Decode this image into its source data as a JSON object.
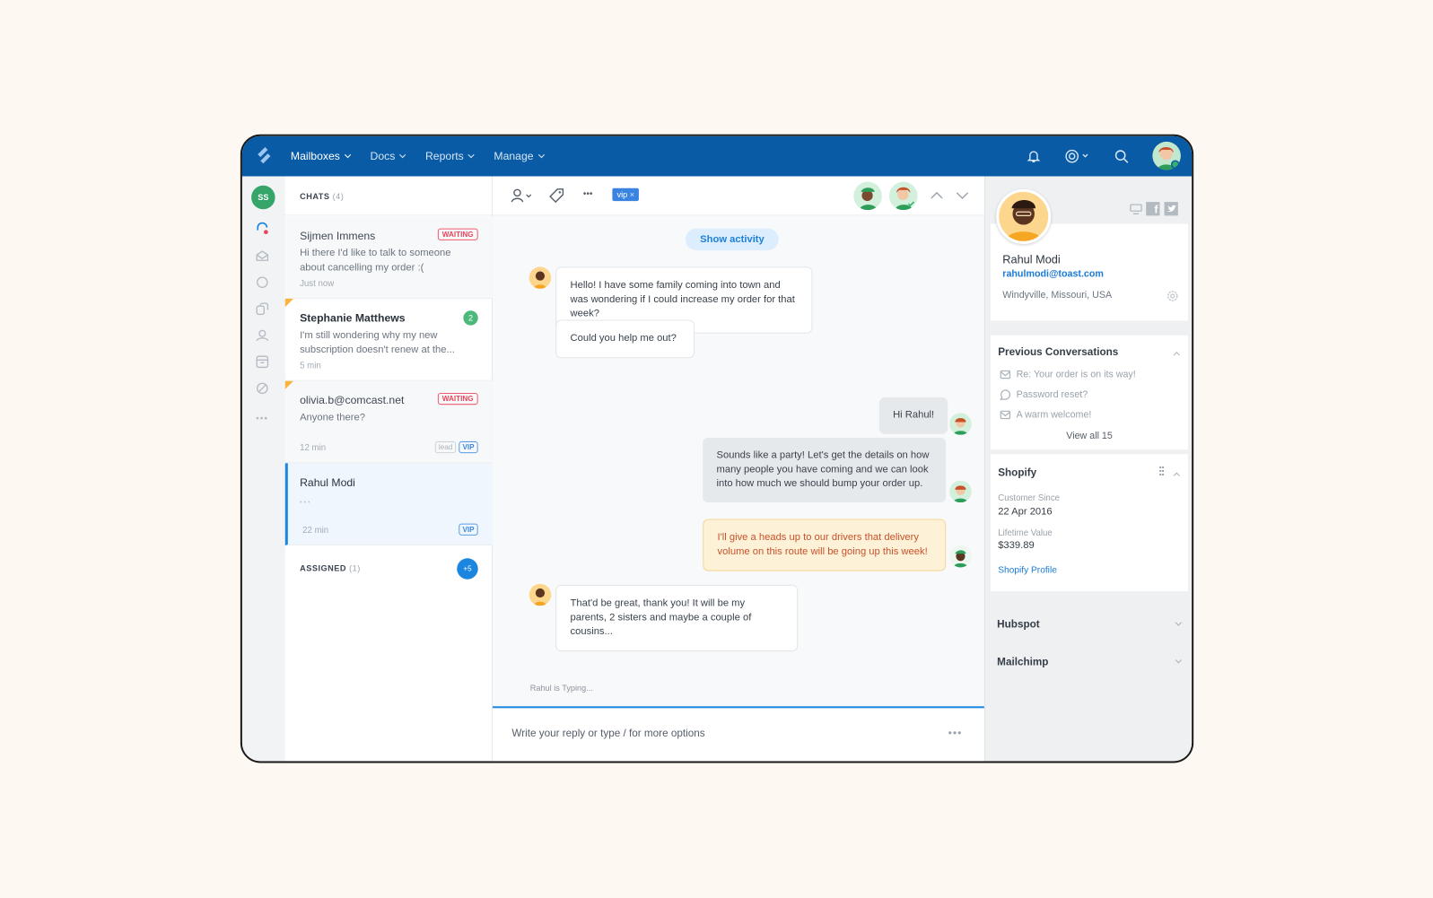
{
  "topbar": {
    "nav": [
      "Mailboxes",
      "Docs",
      "Reports",
      "Manage"
    ]
  },
  "rail": {
    "user_initials": "SS"
  },
  "chats": {
    "title": "CHATS",
    "count": "(4)",
    "items": [
      {
        "name": "Sijmen Immens",
        "preview": "Hi there I'd like to talk to someone about cancelling my order :(",
        "time": "Just now",
        "badge": "WAITING"
      },
      {
        "name": "Stephanie Matthews",
        "preview": "I'm still wondering why my new subscription doesn't renew at the...",
        "time": "5 min",
        "unread": "2"
      },
      {
        "name": "olivia.b@comcast.net",
        "preview": "Anyone there?",
        "time": "12 min",
        "badge": "WAITING",
        "tags": [
          "lead",
          "VIP"
        ]
      },
      {
        "name": "Rahul Modi",
        "preview": "• • •",
        "time": "22 min",
        "tags": [
          "VIP"
        ]
      }
    ],
    "assigned_label": "ASSIGNED",
    "assigned_count": "(1)",
    "assigned_more": "+5"
  },
  "conversation": {
    "tag": "vip",
    "tag_remove": "×",
    "show_activity": "Show activity",
    "messages": [
      {
        "from": "customer",
        "text": "Hello! I have some family coming into town and was wondering if I could increase my order for that week?"
      },
      {
        "from": "customer",
        "text": "Could you help me out?"
      },
      {
        "from": "agent",
        "text": "Hi Rahul!"
      },
      {
        "from": "agent",
        "text": "Sounds like a party! Let's get the details on how many people you have coming and we can look into how much we should bump your order up."
      },
      {
        "from": "note",
        "text": "I'll give a heads up to our drivers that delivery volume on this route will be going up this week!"
      },
      {
        "from": "customer",
        "text": "That'd be great, thank you!  It will be my parents, 2 sisters and maybe a couple of cousins..."
      }
    ],
    "typing": "Rahul is Typing...",
    "reply_placeholder": "Write your reply or type / for more options",
    "more": "•••"
  },
  "customer": {
    "name": "Rahul Modi",
    "email": "rahulmodi@toast.com",
    "location": "Windyville, Missouri, USA"
  },
  "previous": {
    "title": "Previous Conversations",
    "items": [
      {
        "icon": "mail-icon",
        "text": "Re: Your order is on its way!"
      },
      {
        "icon": "chat-bubble-icon",
        "text": "Password reset?"
      },
      {
        "icon": "mail-icon",
        "text": "A warm welcome!"
      }
    ],
    "view_all": "View all 15"
  },
  "shopify": {
    "title": "Shopify",
    "since_label": "Customer Since",
    "since": "22 Apr 2016",
    "ltv_label": "Lifetime Value",
    "ltv": "$339.89",
    "link": "Shopify Profile"
  },
  "integrations": [
    "Hubspot",
    "Mailchimp"
  ],
  "colors": {
    "topbar": "#0a5ba5",
    "accent": "#1b86e0",
    "waiting": "#e8455b",
    "note_bg": "#fdf1d7"
  }
}
